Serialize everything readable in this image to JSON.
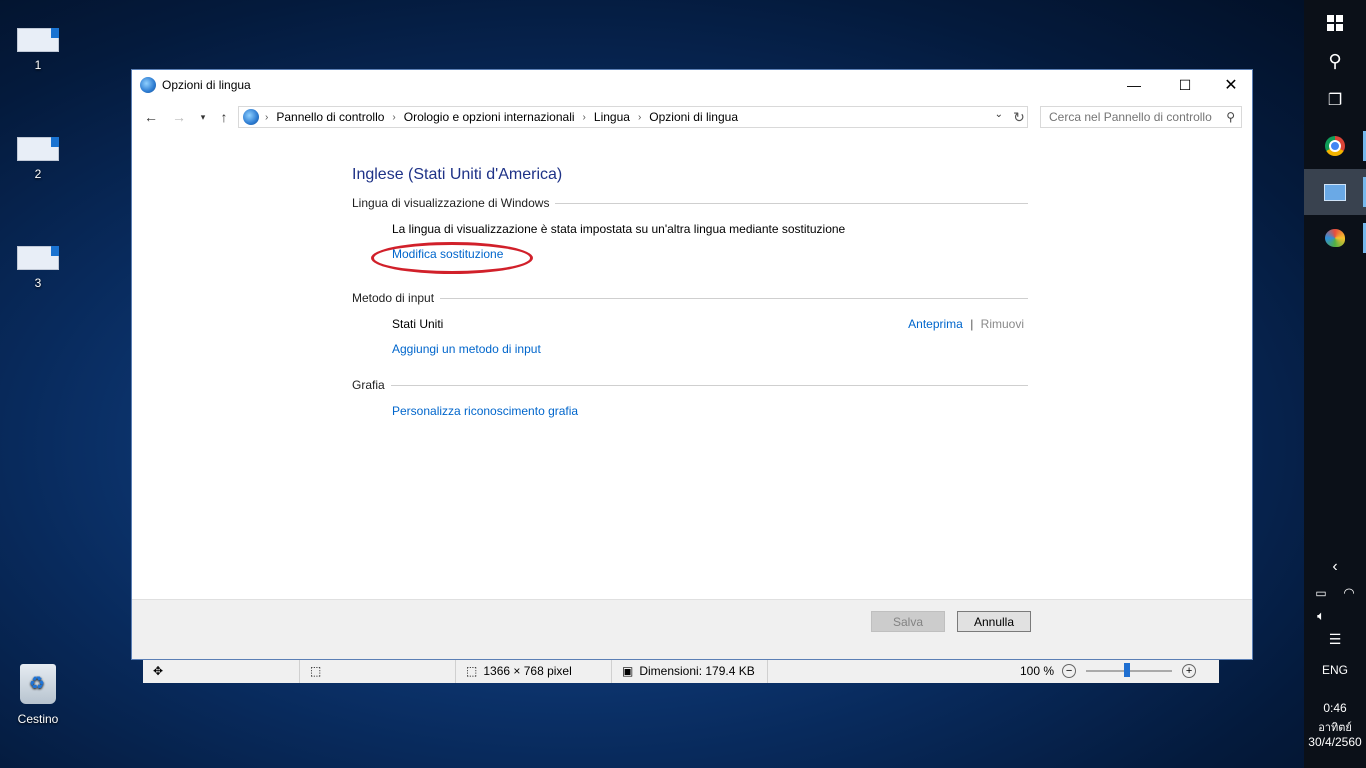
{
  "desktop": {
    "icons": [
      {
        "label": "1"
      },
      {
        "label": "2"
      },
      {
        "label": "3"
      },
      {
        "label": "Cestino"
      }
    ]
  },
  "paint_status": {
    "dimensions": "1366 × 768 pixel",
    "size": "Dimensioni: 179.4 KB",
    "zoom": "100 %"
  },
  "window": {
    "title": "Opzioni di lingua",
    "breadcrumbs": [
      "Pannello di controllo",
      "Orologio e opzioni internazionali",
      "Lingua",
      "Opzioni di lingua"
    ],
    "search_placeholder": "Cerca nel Pannello di controllo",
    "heading": "Inglese (Stati Uniti d'America)",
    "display_language": {
      "title": "Lingua di visualizzazione di Windows",
      "message": "La lingua di visualizzazione è stata impostata su un'altra lingua mediante sostituzione",
      "link": "Modifica sostituzione"
    },
    "input_method": {
      "title": "Metodo di input",
      "item": "Stati Uniti",
      "preview": "Anteprima",
      "separator": "|",
      "remove": "Rimuovi",
      "add": "Aggiungi un metodo di input"
    },
    "handwriting": {
      "title": "Grafia",
      "link": "Personalizza riconoscimento grafia"
    },
    "save_label": "Salva",
    "cancel_label": "Annulla"
  },
  "tray": {
    "language": "ENG",
    "time": "0:46",
    "day": "อาทิตย์",
    "date": "30/4/2560"
  },
  "colors": {
    "link": "#0066cc",
    "heading": "#1e3287",
    "highlight": "#d1202a"
  }
}
